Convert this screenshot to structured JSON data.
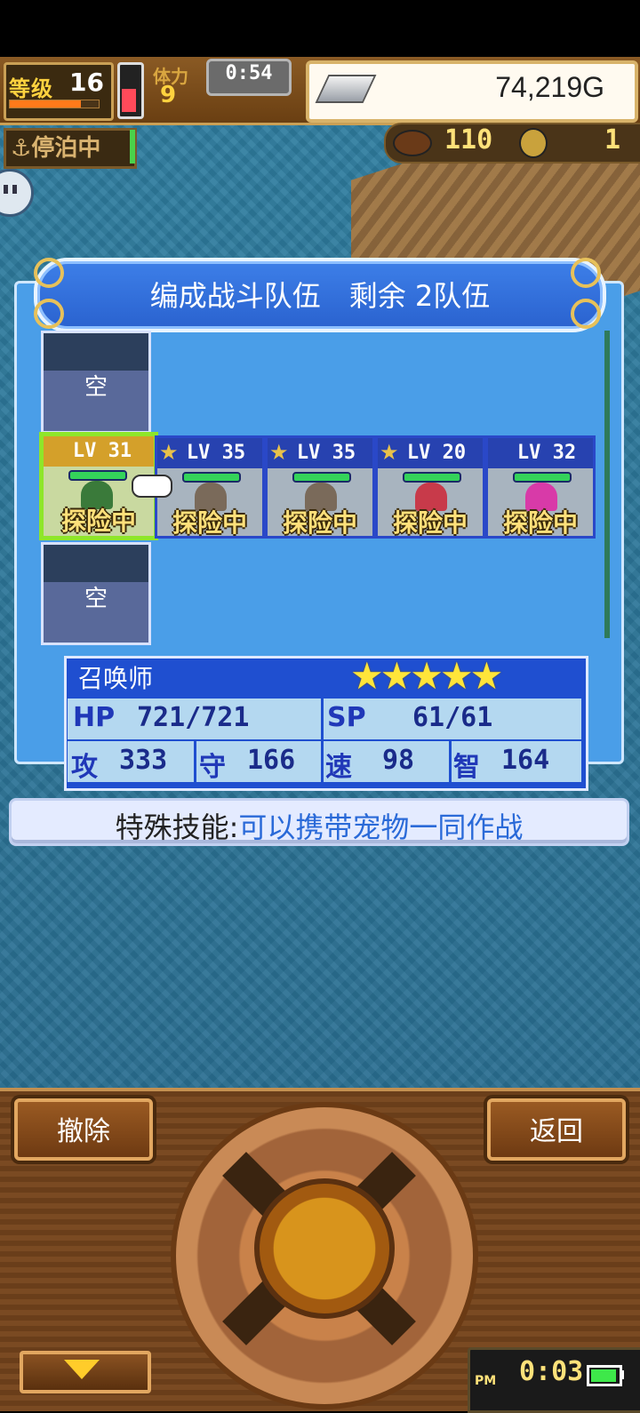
{
  "status_bar": {
    "level_label": "等级",
    "level_value": "16",
    "level_progress": 0.8,
    "stamina_label": "体力",
    "stamina_value": "9",
    "timer": "0:54",
    "gold": "74,219G"
  },
  "dock_status": "停泊中",
  "resources": {
    "food": "110",
    "coins": "1"
  },
  "team_panel": {
    "title": "编成战斗队伍　剩余 2队伍",
    "empty_slot_label": "空",
    "characters": [
      {
        "level": "LV 31",
        "starred": false,
        "status": "探险中",
        "selected": true,
        "color": "#3a7a3a"
      },
      {
        "level": "LV 35",
        "starred": true,
        "status": "探险中",
        "selected": false,
        "color": "#7a6a5a"
      },
      {
        "level": "LV 35",
        "starred": true,
        "status": "探险中",
        "selected": false,
        "color": "#7a6a5a"
      },
      {
        "level": "LV 20",
        "starred": true,
        "status": "探险中",
        "selected": false,
        "color": "#c83a4a"
      },
      {
        "level": "LV 32",
        "starred": false,
        "status": "探险中",
        "selected": false,
        "color": "#d83aa8"
      }
    ]
  },
  "character_info": {
    "job": "召唤师",
    "rank_stars": 5,
    "stars_text": "★★★★★",
    "hp_label": "HP",
    "hp_value": "721/721",
    "sp_label": "SP",
    "sp_value": "61/61",
    "atk_label": "攻",
    "atk_value": "333",
    "def_label": "守",
    "def_value": "166",
    "spd_label": "速",
    "spd_value": "98",
    "int_label": "智",
    "int_value": "164"
  },
  "skill": {
    "label": "特殊技能:",
    "value": "可以携带宠物一同作战"
  },
  "controls": {
    "remove_label": "撤除",
    "back_label": "返回"
  },
  "clock": {
    "period": "PM",
    "time": "0:03"
  }
}
